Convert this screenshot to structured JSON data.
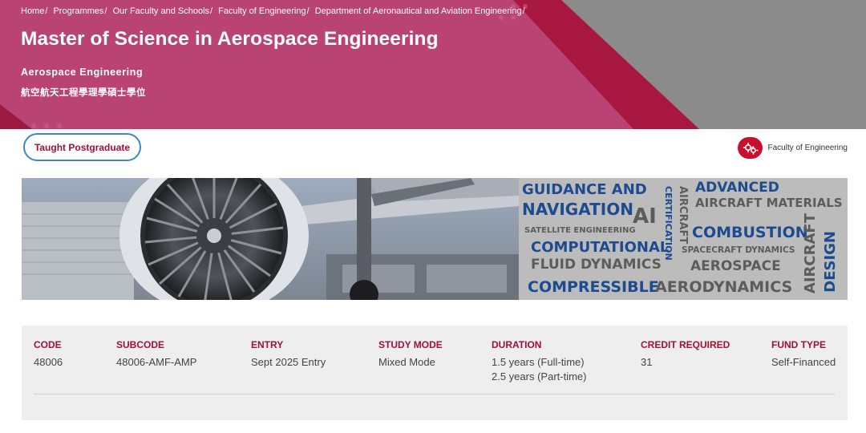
{
  "breadcrumb": [
    {
      "label": "Home"
    },
    {
      "label": "Programmes"
    },
    {
      "label": "Our Faculty and Schools"
    },
    {
      "label": "Faculty of Engineering"
    },
    {
      "label": "Department of Aeronautical and Aviation Engineering"
    }
  ],
  "breadcrumb_separator": "/",
  "header": {
    "title": "Master of Science in Aerospace Engineering",
    "subtitle": "Aerospace Engineering",
    "chinese_title": "航空航天工程學理學碩士學位"
  },
  "programme_type": "Taught Postgraduate",
  "faculty": {
    "label": "Faculty of Engineering",
    "icon": "gears-icon"
  },
  "banner": {
    "keywords": [
      "GUIDANCE AND",
      "NAVIGATION",
      "AI",
      "AIRCRAFT",
      "CERTIFICATION",
      "ADVANCED",
      "AIRCRAFT MATERIALS",
      "SATELLITE ENGINEERING",
      "COMPUTATIONAL",
      "FLUID DYNAMICS",
      "COMBUSTION",
      "SPACECRAFT DYNAMICS",
      "AEROSPACE",
      "COMPRESSIBLE",
      "AERODYNAMICS",
      "AIRCRAFT",
      "DESIGN"
    ]
  },
  "programme_info": [
    {
      "label": "CODE",
      "values": [
        "48006"
      ]
    },
    {
      "label": "SUBCODE",
      "values": [
        "48006-AMF-AMP"
      ]
    },
    {
      "label": "ENTRY",
      "values": [
        "Sept 2025 Entry"
      ]
    },
    {
      "label": "STUDY MODE",
      "values": [
        "Mixed Mode"
      ]
    },
    {
      "label": "DURATION",
      "values": [
        "1.5 years (Full-time)",
        "2.5 years (Part-time)"
      ]
    },
    {
      "label": "CREDIT REQUIRED",
      "values": [
        "31"
      ]
    },
    {
      "label": "FUND TYPE",
      "values": [
        "Self-Financed"
      ]
    }
  ],
  "colors": {
    "hero_pink": "#b94474",
    "hero_crimson": "#a8173f",
    "hero_grey": "#8b8b8b",
    "accent_red": "#9e1237",
    "button_border": "#3a87c8",
    "wordcloud_blue": "#1e4b8f"
  }
}
